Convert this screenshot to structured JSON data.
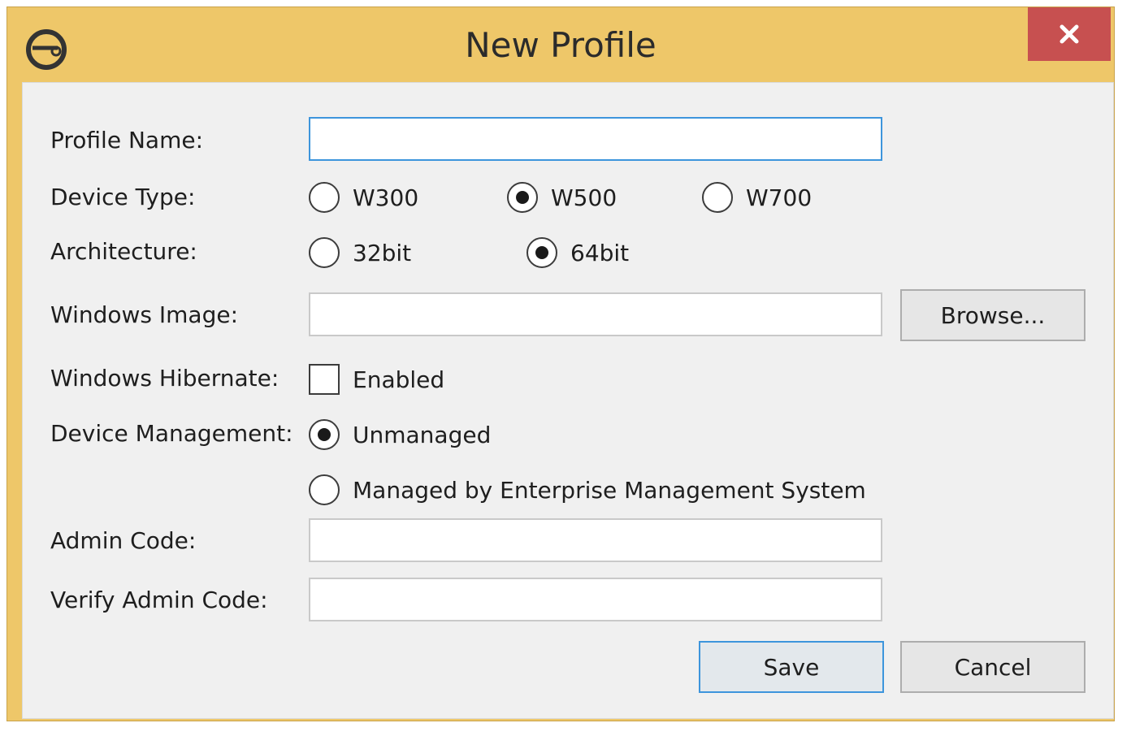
{
  "window": {
    "title": "New Profile",
    "close_glyph": "✕",
    "app_icon": "profile-key-icon"
  },
  "form": {
    "profile_name": {
      "label": "Profile Name:",
      "value": ""
    },
    "device_type": {
      "label": "Device Type:",
      "options": [
        "W300",
        "W500",
        "W700"
      ],
      "selected": "W500"
    },
    "architecture": {
      "label": "Architecture:",
      "options": [
        "32bit",
        "64bit"
      ],
      "selected": "64bit"
    },
    "windows_image": {
      "label": "Windows Image:",
      "value": "",
      "browse_label": "Browse..."
    },
    "windows_hibernate": {
      "label": "Windows Hibernate:",
      "checkbox_label": "Enabled",
      "checked": false
    },
    "device_management": {
      "label": "Device Management:",
      "options": [
        "Unmanaged",
        "Managed by Enterprise Management System"
      ],
      "selected": "Unmanaged"
    },
    "admin_code": {
      "label": "Admin Code:",
      "value": ""
    },
    "verify_admin_code": {
      "label": "Verify Admin Code:",
      "value": ""
    }
  },
  "buttons": {
    "save_label": "Save",
    "cancel_label": "Cancel"
  },
  "colors": {
    "title_bar": "#eec769",
    "close_button": "#c75050",
    "focus_accent": "#3d95dc"
  }
}
